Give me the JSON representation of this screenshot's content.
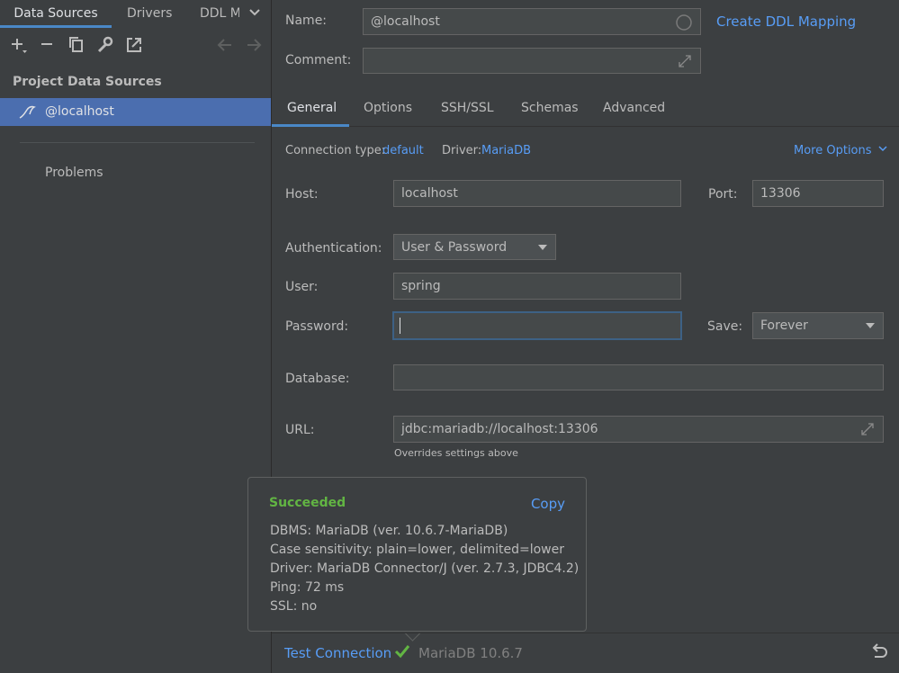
{
  "left_panel": {
    "tabs": [
      {
        "label": "Data Sources"
      },
      {
        "label": "Drivers"
      },
      {
        "label": "DDL Mappings"
      }
    ],
    "toolbar_icons": [
      "add-icon",
      "remove-icon",
      "duplicate-icon",
      "wrench-icon",
      "open-external-icon",
      "arrow-left-icon",
      "arrow-right-icon"
    ],
    "section_title": "Project Data Sources",
    "items": [
      {
        "label": "@localhost",
        "icon": "mariadb-seal-icon"
      }
    ],
    "problems_label": "Problems"
  },
  "header": {
    "name_label": "Name:",
    "name_value": "@localhost",
    "comment_label": "Comment:",
    "comment_value": "",
    "create_ddl_link": "Create DDL Mapping"
  },
  "tabs": [
    {
      "label": "General"
    },
    {
      "label": "Options"
    },
    {
      "label": "SSH/SSL"
    },
    {
      "label": "Schemas"
    },
    {
      "label": "Advanced"
    }
  ],
  "general": {
    "connection_type_label": "Connection type:",
    "connection_type_value": "default",
    "driver_label": "Driver:",
    "driver_value": "MariaDB",
    "more_options": "More Options",
    "host_label": "Host:",
    "host_value": "localhost",
    "port_label": "Port:",
    "port_value": "13306",
    "auth_label": "Authentication:",
    "auth_value": "User & Password",
    "user_label": "User:",
    "user_value": "spring",
    "password_label": "Password:",
    "password_value": "",
    "save_label": "Save:",
    "save_value": "Forever",
    "database_label": "Database:",
    "database_value": "",
    "url_label": "URL:",
    "url_value": "jdbc:mariadb://localhost:13306",
    "url_hint": "Overrides settings above"
  },
  "popup": {
    "status": "Succeeded",
    "copy_label": "Copy",
    "lines": [
      "DBMS: MariaDB (ver. 10.6.7-MariaDB)",
      "Case sensitivity: plain=lower, delimited=lower",
      "Driver: MariaDB Connector/J (ver. 2.7.3, JDBC4.2)",
      "Ping: 72 ms",
      "SSL: no"
    ]
  },
  "bottom": {
    "test_connection": "Test Connection",
    "version": "MariaDB 10.6.7"
  },
  "colors": {
    "background": "#3c3f41",
    "selection": "#4b6eaf",
    "link": "#589df6",
    "success": "#62b543",
    "focus": "#3d6185"
  }
}
